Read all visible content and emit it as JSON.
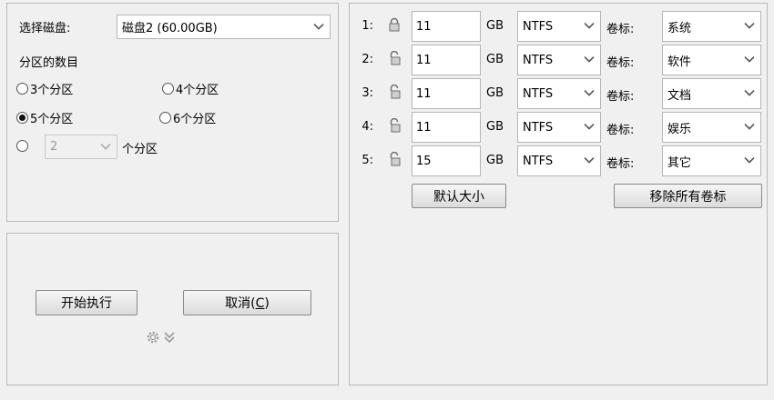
{
  "disk": {
    "label": "选择磁盘:",
    "selected": "磁盘2 (60.00GB)"
  },
  "count": {
    "label": "分区的数目",
    "options": [
      "3个分区",
      "4个分区",
      "5个分区",
      "6个分区"
    ],
    "selected": "5个分区",
    "custom_value": "2",
    "custom_suffix": "个分区"
  },
  "actions": {
    "start": "开始执行",
    "cancel_pre": "取消(",
    "cancel_key": "C",
    "cancel_post": ")"
  },
  "partitions": [
    {
      "num": "1:",
      "size": "11",
      "unit": "GB",
      "fs": "NTFS",
      "vol_label": "卷标:",
      "volume": "系统",
      "locked": true
    },
    {
      "num": "2:",
      "size": "11",
      "unit": "GB",
      "fs": "NTFS",
      "vol_label": "卷标:",
      "volume": "软件",
      "locked": false
    },
    {
      "num": "3:",
      "size": "11",
      "unit": "GB",
      "fs": "NTFS",
      "vol_label": "卷标:",
      "volume": "文档",
      "locked": false
    },
    {
      "num": "4:",
      "size": "11",
      "unit": "GB",
      "fs": "NTFS",
      "vol_label": "卷标:",
      "volume": "娱乐",
      "locked": false
    },
    {
      "num": "5:",
      "size": "15",
      "unit": "GB",
      "fs": "NTFS",
      "vol_label": "卷标:",
      "volume": "其它",
      "locked": false
    }
  ],
  "right_buttons": {
    "default_size": "默认大小",
    "remove_labels": "移除所有卷标"
  },
  "icons": {
    "gear": "gear-icon",
    "expand": "double-chevron-down-icon",
    "lock_closed": "lock-closed-icon",
    "lock_open": "lock-open-icon"
  }
}
